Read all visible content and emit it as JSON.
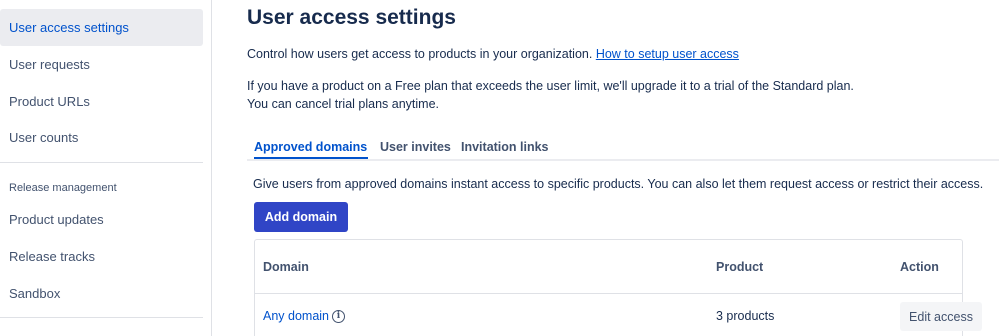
{
  "sidebar": {
    "items": [
      {
        "label": "User access settings",
        "active": true
      },
      {
        "label": "User requests"
      },
      {
        "label": "Product URLs"
      },
      {
        "label": "User counts"
      }
    ],
    "section_label": "Release management",
    "section_items": [
      {
        "label": "Product updates"
      },
      {
        "label": "Release tracks"
      },
      {
        "label": "Sandbox"
      }
    ]
  },
  "main": {
    "title": "User access settings",
    "intro": "Control how users get access to products in your organization.",
    "intro_link": "How to setup user access",
    "paragraph_line1": "If you have a product on a Free plan that exceeds the user limit, we'll upgrade it to a trial of the Standard plan.",
    "paragraph_line2": "You can cancel trial plans anytime.",
    "tabs": [
      {
        "label": "Approved domains",
        "active": true
      },
      {
        "label": "User invites"
      },
      {
        "label": "Invitation links"
      }
    ],
    "tab_description": "Give users from approved domains instant access to specific products. You can also let them request access or restrict their access.",
    "add_button": "Add domain",
    "table": {
      "headers": [
        "Domain",
        "Product",
        "Action"
      ],
      "rows": [
        {
          "domain": "Any domain",
          "product": "3 products",
          "action": "Edit access"
        }
      ]
    }
  },
  "colors": {
    "accent": "#0052cc",
    "primary_button": "#3045c6",
    "active_nav_bg": "#ebecf0"
  },
  "icons": {
    "info": "info-icon"
  }
}
